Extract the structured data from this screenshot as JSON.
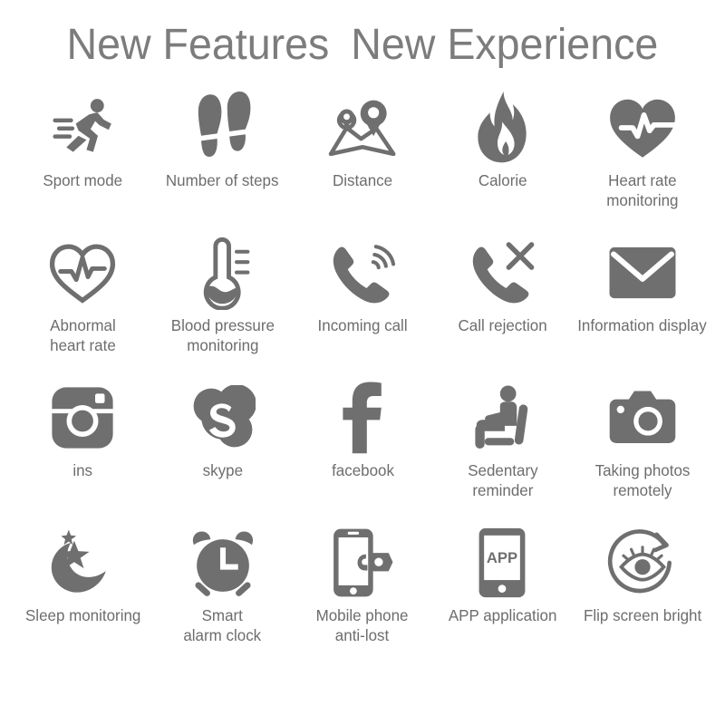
{
  "title": {
    "part1": "New Features",
    "part2": "New Experience"
  },
  "colors": {
    "icon": "#6f6f6f",
    "label": "#6d6d6d",
    "title": "#7c7c7c",
    "background": "#ffffff"
  },
  "grid": {
    "columns": 5,
    "rows": [
      {
        "cells": [
          {
            "label": "Sport mode",
            "icon": "running-person-icon"
          },
          {
            "label": "Number of steps",
            "icon": "footprints-icon"
          },
          {
            "label": "Distance",
            "icon": "map-location-pin-icon"
          },
          {
            "label": "Calorie",
            "icon": "flame-icon"
          },
          {
            "label": "Heart rate\nmonitoring",
            "icon": "heart-pulse-filled-icon"
          }
        ]
      },
      {
        "cells": [
          {
            "label": "Abnormal\nheart rate",
            "icon": "heart-pulse-outline-icon"
          },
          {
            "label": "Blood pressure\nmonitoring",
            "icon": "thermometer-icon"
          },
          {
            "label": "Incoming call",
            "icon": "phone-ringing-icon"
          },
          {
            "label": "Call rejection",
            "icon": "phone-reject-icon"
          },
          {
            "label": "Information display",
            "icon": "envelope-icon"
          }
        ]
      },
      {
        "cells": [
          {
            "label": "ins",
            "icon": "instagram-icon"
          },
          {
            "label": "skype",
            "icon": "skype-icon"
          },
          {
            "label": "facebook",
            "icon": "facebook-icon"
          },
          {
            "label": "Sedentary\nreminder",
            "icon": "sitting-person-icon"
          },
          {
            "label": "Taking photos\nremotely",
            "icon": "camera-icon"
          }
        ]
      },
      {
        "cells": [
          {
            "label": "Sleep monitoring",
            "icon": "moon-stars-icon"
          },
          {
            "label": "Smart\nalarm clock",
            "icon": "alarm-clock-icon"
          },
          {
            "label": "Mobile phone\nanti-lost",
            "icon": "phone-lock-icon"
          },
          {
            "label": "APP application",
            "icon": "app-phone-icon"
          },
          {
            "label": "Flip screen bright",
            "icon": "eye-rotate-icon"
          }
        ]
      }
    ]
  },
  "app_badge_text": "APP"
}
